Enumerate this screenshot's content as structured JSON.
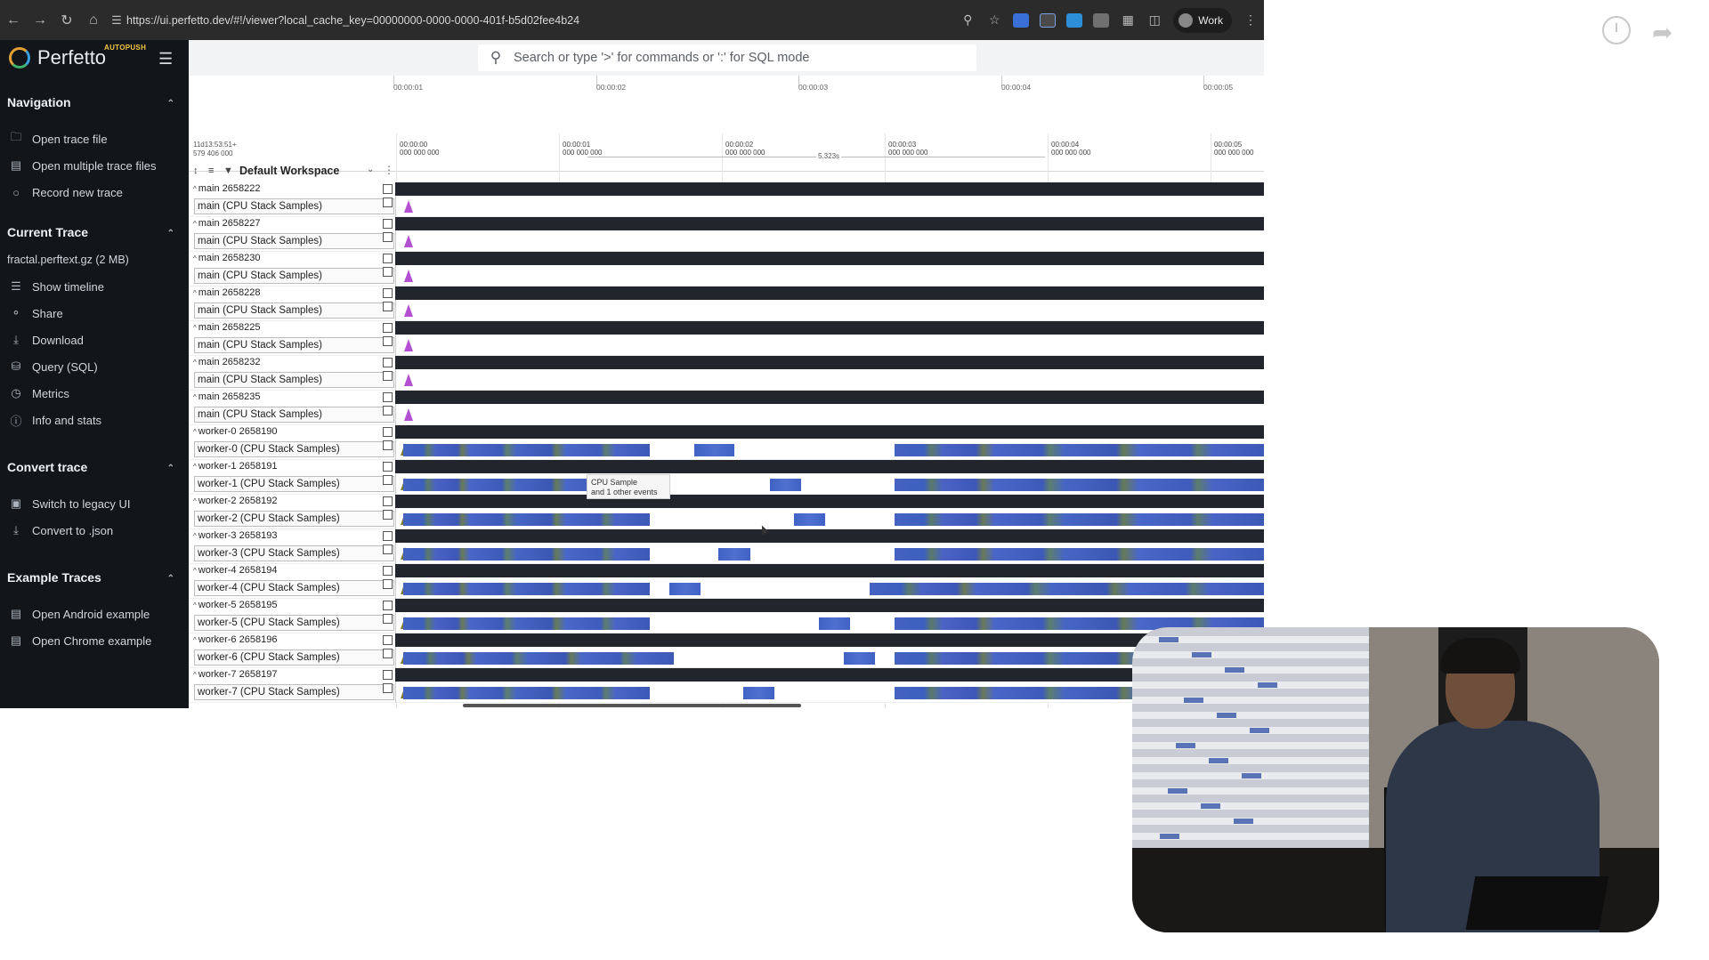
{
  "browser": {
    "url": "https://ui.perfetto.dev/#!/viewer?local_cache_key=00000000-0000-0000-401f-b5d02fee4b24",
    "profile_label": "Work"
  },
  "app": {
    "name": "Perfetto",
    "channel": "AUTOPUSH",
    "search_placeholder": "Search or type '>' for commands or ':' for SQL mode"
  },
  "sidebar": {
    "sections": [
      {
        "title": "Navigation",
        "items": [
          {
            "label": "Open trace file",
            "icon": "folder-icon"
          },
          {
            "label": "Open multiple trace files",
            "icon": "folders-icon"
          },
          {
            "label": "Record new trace",
            "icon": "record-icon"
          }
        ]
      },
      {
        "title": "Current Trace",
        "info": "fractal.perftext.gz (2 MB)",
        "items": [
          {
            "label": "Show timeline",
            "icon": "timeline-icon"
          },
          {
            "label": "Share",
            "icon": "share-icon"
          },
          {
            "label": "Download",
            "icon": "download-icon"
          },
          {
            "label": "Query (SQL)",
            "icon": "database-icon"
          },
          {
            "label": "Metrics",
            "icon": "metrics-icon"
          },
          {
            "label": "Info and stats",
            "icon": "info-icon"
          }
        ]
      },
      {
        "title": "Convert trace",
        "items": [
          {
            "label": "Switch to legacy UI",
            "icon": "legacy-ui-icon"
          },
          {
            "label": "Convert to .json",
            "icon": "convert-icon"
          }
        ]
      },
      {
        "title": "Example Traces",
        "items": [
          {
            "label": "Open Android example",
            "icon": "document-icon"
          },
          {
            "label": "Open Chrome example",
            "icon": "document-icon"
          }
        ]
      }
    ]
  },
  "overview": {
    "labels": [
      "00:00:01",
      "00:00:02",
      "00:00:03",
      "00:00:04",
      "00:00:05"
    ]
  },
  "timeline": {
    "offset_line1": "11d13:53:51+",
    "offset_line2": "579 406 000",
    "ticks": [
      {
        "top": "00:00:00",
        "bottom": "000 000 000"
      },
      {
        "top": "00:00:01",
        "bottom": "000 000 000"
      },
      {
        "top": "00:00:02",
        "bottom": "000 000 000"
      },
      {
        "top": "00:00:03",
        "bottom": "000 000 000"
      },
      {
        "top": "00:00:04",
        "bottom": "000 000 000"
      },
      {
        "top": "00:00:05",
        "bottom": "000 000 000"
      }
    ],
    "span_label": "5.323s",
    "workspace": "Default Workspace"
  },
  "tracks": [
    {
      "group": "main 2658222",
      "track": "main (CPU Stack Samples)"
    },
    {
      "group": "main 2658227",
      "track": "main (CPU Stack Samples)"
    },
    {
      "group": "main 2658230",
      "track": "main (CPU Stack Samples)"
    },
    {
      "group": "main 2658228",
      "track": "main (CPU Stack Samples)"
    },
    {
      "group": "main 2658225",
      "track": "main (CPU Stack Samples)"
    },
    {
      "group": "main 2658232",
      "track": "main (CPU Stack Samples)"
    },
    {
      "group": "main 2658235",
      "track": "main (CPU Stack Samples)"
    },
    {
      "group": "worker-0 2658190",
      "track": "worker-0 (CPU Stack Samples)"
    },
    {
      "group": "worker-1 2658191",
      "track": "worker-1 (CPU Stack Samples)"
    },
    {
      "group": "worker-2 2658192",
      "track": "worker-2 (CPU Stack Samples)"
    },
    {
      "group": "worker-3 2658193",
      "track": "worker-3 (CPU Stack Samples)"
    },
    {
      "group": "worker-4 2658194",
      "track": "worker-4 (CPU Stack Samples)"
    },
    {
      "group": "worker-5 2658195",
      "track": "worker-5 (CPU Stack Samples)"
    },
    {
      "group": "worker-6 2658196",
      "track": "worker-6 (CPU Stack Samples)"
    },
    {
      "group": "worker-7 2658197",
      "track": "worker-7 (CPU Stack Samples)"
    }
  ],
  "tooltip": {
    "line1": "CPU Sample",
    "line2": "and 1 other events"
  },
  "colors": {
    "sidebar_bg": "#12161b",
    "group_header": "#22262c",
    "sample_spike": "#b34fd1",
    "sample_block": "#4563c0",
    "logo_accent": "#f3c640"
  }
}
